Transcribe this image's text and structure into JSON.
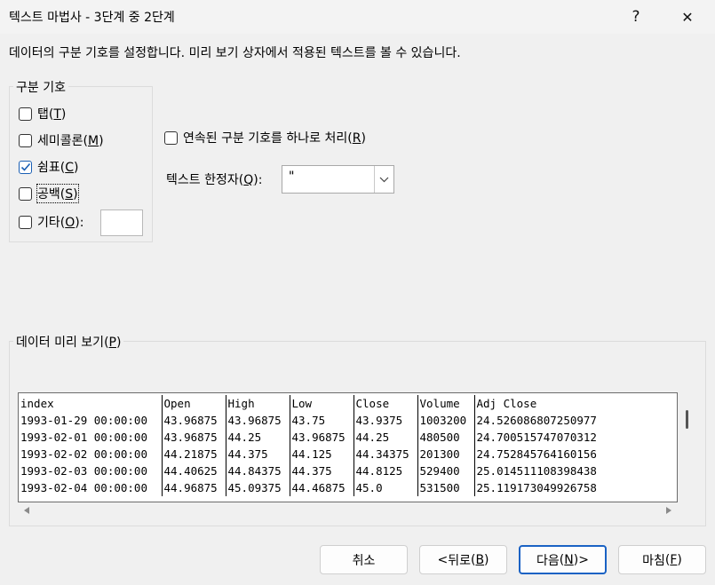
{
  "window": {
    "title": "텍스트 마법사 - 3단계 중 2단계",
    "help_glyph": "?",
    "close_glyph": "✕"
  },
  "description": "데이터의 구분 기호를 설정합니다. 미리 보기 상자에서 적용된 텍스트를 볼 수 있습니다.",
  "delimiters": {
    "legend": "구분 기호",
    "tab": {
      "label": "탭",
      "key": "T",
      "checked": false
    },
    "semicolon": {
      "label": "세미콜론",
      "key": "M",
      "checked": false
    },
    "comma": {
      "label": "쉼표",
      "key": "C",
      "checked": true
    },
    "space": {
      "label": "공백",
      "key": "S",
      "checked": false
    },
    "other": {
      "label": "기타",
      "key": "O",
      "checked": false,
      "value": ""
    }
  },
  "consecutive": {
    "label": "연속된 구분 기호를 하나로 처리",
    "key": "R",
    "checked": false
  },
  "text_qualifier": {
    "label": "텍스트 한정자",
    "key": "Q",
    "value": "\""
  },
  "preview": {
    "legend": "데이터 미리 보기",
    "key": "P",
    "rows": [
      [
        "index",
        "Open",
        "High",
        "Low",
        "Close",
        "Volume",
        "Adj Close"
      ],
      [
        "1993-01-29 00:00:00",
        "43.96875",
        "43.96875",
        "43.75",
        "43.9375",
        "1003200",
        "24.526086807250977"
      ],
      [
        "1993-02-01 00:00:00",
        "43.96875",
        "44.25",
        "43.96875",
        "44.25",
        "480500",
        "24.700515747070312"
      ],
      [
        "1993-02-02 00:00:00",
        "44.21875",
        "44.375",
        "44.125",
        "44.34375",
        "201300",
        "24.752845764160156"
      ],
      [
        "1993-02-03 00:00:00",
        "44.40625",
        "44.84375",
        "44.375",
        "44.8125",
        "529400",
        "25.014511108398438"
      ],
      [
        "1993-02-04 00:00:00",
        "44.96875",
        "45.09375",
        "44.46875",
        "45.0",
        "531500",
        "25.119173049926758"
      ]
    ]
  },
  "buttons": {
    "cancel": {
      "label": "취소"
    },
    "back": {
      "prefix": "< ",
      "label": "뒤로",
      "key": "B"
    },
    "next": {
      "label": "다음",
      "key": "N",
      "suffix": " >"
    },
    "finish": {
      "label": "마침",
      "key": "F"
    }
  },
  "colors": {
    "accent": "#1a62c4",
    "background": "#f0f0f0"
  }
}
